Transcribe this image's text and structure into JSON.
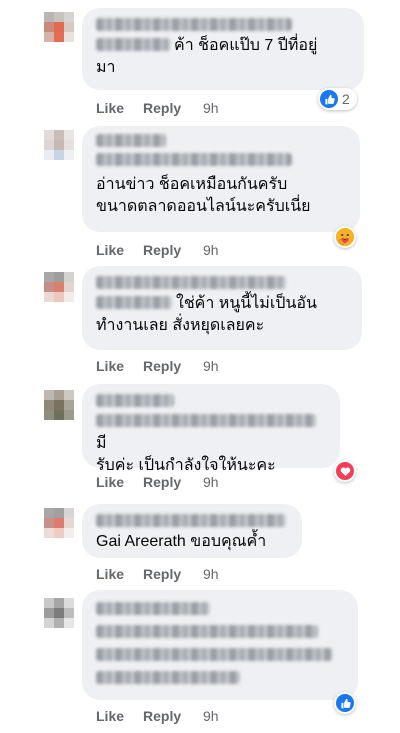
{
  "actions": {
    "like": "Like",
    "reply": "Reply"
  },
  "colors": {
    "like_blue": "#1877f2",
    "love_red": "#f33e58",
    "care_yellow": "#f7b125",
    "bubble": "#eff0f3",
    "meta": "#65676b"
  },
  "comments": [
    {
      "author": "blurred-name",
      "line1": "ค้า ช็อคแป๊บ 7 ปีที่อยู่",
      "line2": "มา",
      "time": "9h",
      "reaction": "like-icon",
      "reaction_count": "2"
    },
    {
      "author": "blurred-name",
      "line1": "อ่านข่าว ช็อคเหมือนกันครับ",
      "line2": "ขนาดตลาดออนไลน์นะครับเนี่ย",
      "time": "9h",
      "reaction": "care-icon"
    },
    {
      "author": "blurred-name",
      "line1": "ใช่ค้า หนูนี้ไม่เป็นอัน",
      "line2": "ทำงานเลย สั่งหยุดเลยคะ",
      "time": "9h"
    },
    {
      "author": "blurred-name",
      "line1": "มี",
      "line2": "รับค่ะ เป็นกำลังใจให้นะคะ",
      "time": "9h",
      "reaction": "love-icon"
    },
    {
      "author": "blurred-name",
      "line1": "Gai Areerath ขอบคุณค้ำ",
      "time": "9h"
    },
    {
      "author": "blurred-name",
      "time": "9h",
      "reaction": "like-icon"
    }
  ]
}
